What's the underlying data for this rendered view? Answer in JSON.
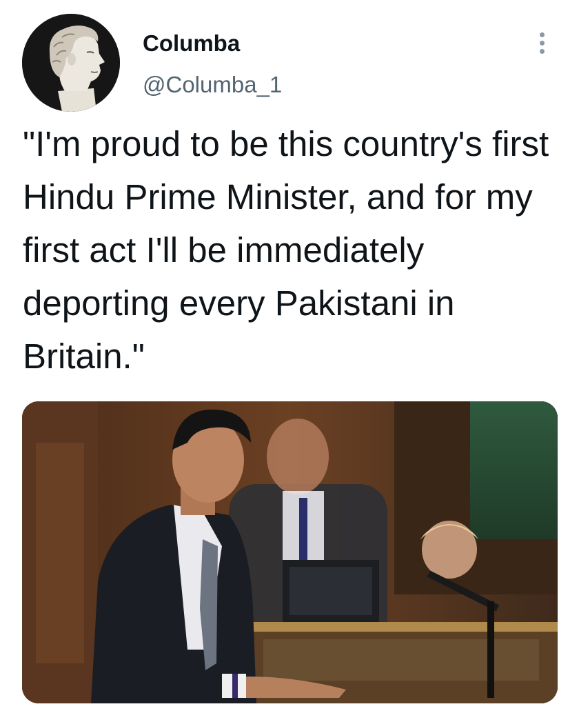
{
  "tweet": {
    "author": {
      "display_name": "Columba",
      "handle": "@Columba_1",
      "avatar_icon": "classical-bust-icon"
    },
    "text": "\"I'm proud to be this country's first Hindu Prime Minister, and for my first act I'll be immediately deporting every Pakistani in Britain.\"",
    "more_icon": "more-vertical-icon",
    "media": {
      "kind": "photo",
      "description_icon": "photo-icon"
    }
  },
  "colors": {
    "text": "#0f1419",
    "secondary": "#536471",
    "more_dots": "#8b98a5"
  }
}
